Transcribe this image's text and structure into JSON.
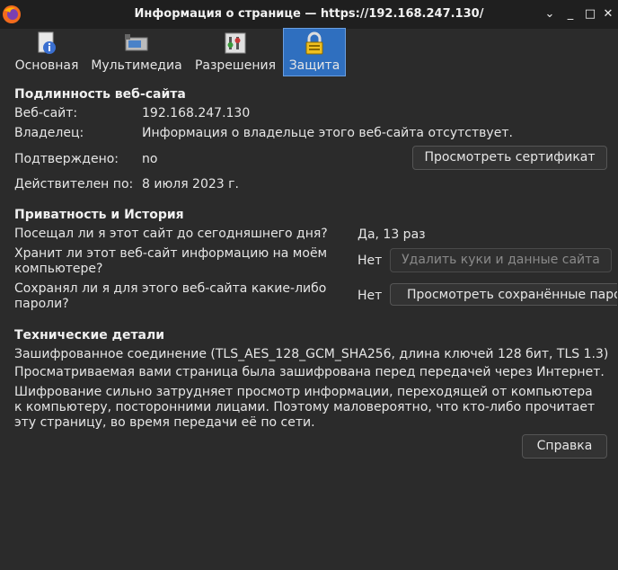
{
  "window": {
    "title": "Информация о странице — https://192.168.247.130/",
    "minimize": "_",
    "maximize": "□",
    "close": "✕"
  },
  "tabs": [
    {
      "label": "Основная",
      "icon": "page-info-icon"
    },
    {
      "label": "Мультимедиа",
      "icon": "media-icon"
    },
    {
      "label": "Разрешения",
      "icon": "permissions-icon"
    },
    {
      "label": "Защита",
      "icon": "lock-icon",
      "selected": true
    }
  ],
  "identity": {
    "heading": "Подлинность веб-сайта",
    "website_label": "Веб-сайт:",
    "website_value": "192.168.247.130",
    "owner_label": "Владелец:",
    "owner_value": "Информация о владельце этого веб-сайта отсутствует.",
    "verified_label": "Подтверждено:",
    "verified_value": "no",
    "view_cert_button": "Просмотреть сертификат",
    "expires_label": "Действителен по:",
    "expires_value": "8 июля 2023 г."
  },
  "privacy": {
    "heading": "Приватность и История",
    "visited_question": "Посещал ли я этот сайт до сегодняшнего дня?",
    "visited_answer": "Да, 13 раз",
    "cookies_question": "Хранит ли этот веб-сайт информацию на моём компьютере?",
    "cookies_answer": "Нет",
    "clear_cookies_button": "Удалить куки и данные сайта",
    "passwords_question": "Сохранял ли я для этого веб-сайта какие-либо пароли?",
    "passwords_answer": "Нет",
    "view_passwords_button": "Просмотреть сохранённые пароли"
  },
  "technical": {
    "heading": "Технические детали",
    "line1": "Зашифрованное соединение (TLS_AES_128_GCM_SHA256, длина ключей 128 бит, TLS 1.3)",
    "line2": "Просматриваемая вами страница была зашифрована перед передачей через Интернет.",
    "line3": "Шифрование сильно затрудняет просмотр информации, переходящей от компьютера к компьютеру, посторонними лицами. Поэтому маловероятно, что кто-либо прочитает эту страницу, во время передачи её по сети."
  },
  "help_button": "Справка"
}
